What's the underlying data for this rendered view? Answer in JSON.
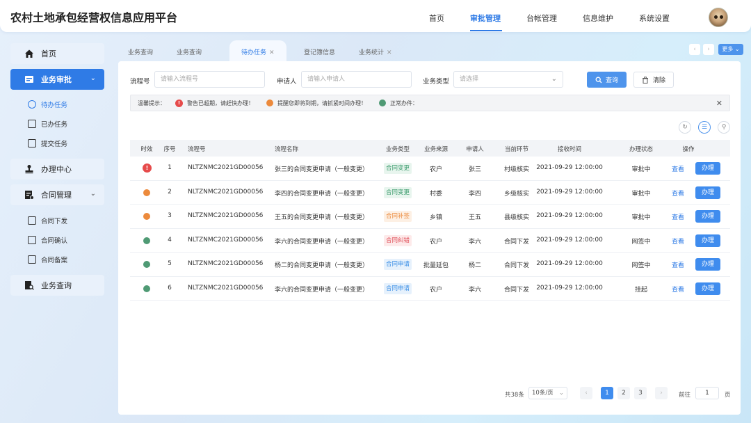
{
  "app": {
    "title": "农村土地承包经营权信息应用平台"
  },
  "topnav": [
    "首页",
    "审批管理",
    "台帐管理",
    "信息维护",
    "系统设置"
  ],
  "sidebar": {
    "home": "首页",
    "approval": "业务审批",
    "todo": "待办任务",
    "done": "已办任务",
    "submitted": "提交任务",
    "center": "办理中心",
    "contract": "合同管理",
    "issue": "合同下发",
    "confirm": "合同确认",
    "record": "合同备案",
    "query": "业务查询"
  },
  "tabs": [
    "业务查询",
    "业务查询",
    "待办任务",
    "登记簿信息",
    "业务统计"
  ],
  "more": "更多",
  "filters": {
    "flow_no_label": "流程号",
    "flow_no_placeholder": "请输入流程号",
    "applicant_label": "申请人",
    "applicant_placeholder": "请输入申请人",
    "type_label": "业务类型",
    "type_placeholder": "请选择",
    "query_btn": "查询",
    "clear_btn": "清除"
  },
  "tips": {
    "label": "温馨提示：",
    "warn": "警告已超期，请赶快办理！",
    "remind": "提醒您即将到期，请抓紧时间办理！",
    "normal": "正常办件："
  },
  "colors": {
    "accent": "#2f7be6",
    "orange": "#ec8a3c",
    "green": "#4f9a74",
    "red": "#e64b4b"
  },
  "table": {
    "headers": [
      "时效",
      "序号",
      "流程号",
      "流程名称",
      "业务类型",
      "业务来源",
      "申请人",
      "当前环节",
      "接收时间",
      "办理状态",
      "操作"
    ],
    "rows": [
      {
        "status": "alarm",
        "no": "1",
        "flow": "NLTZNMC2021GD00056",
        "name": "张三的合同变更申请（一般变更）",
        "type": "合同变更",
        "tag": "green",
        "source": "农户",
        "applicant": "张三",
        "step": "村级核实",
        "time": "2021-09-29 12:00:00",
        "state": "审批中",
        "view": "查看",
        "handle": "办理"
      },
      {
        "status": "orange",
        "no": "2",
        "flow": "NLTZNMC2021GD00056",
        "name": "李四的合同变更申请（一般变更）",
        "type": "合同变更",
        "tag": "green",
        "source": "村委",
        "applicant": "李四",
        "step": "乡级核实",
        "time": "2021-09-29 12:00:00",
        "state": "审批中",
        "view": "查看",
        "handle": "办理"
      },
      {
        "status": "orange",
        "no": "3",
        "flow": "NLTZNMC2021GD00056",
        "name": "王五的合同变更申请（一般变更）",
        "type": "合同补签",
        "tag": "orange",
        "source": "乡镇",
        "applicant": "王五",
        "step": "县级核实",
        "time": "2021-09-29 12:00:00",
        "state": "审批中",
        "view": "查看",
        "handle": "办理"
      },
      {
        "status": "green",
        "no": "4",
        "flow": "NLTZNMC2021GD00056",
        "name": "李六的合同变更申请（一般变更）",
        "type": "合同纠错",
        "tag": "red",
        "source": "农户",
        "applicant": "李六",
        "step": "合同下发",
        "time": "2021-09-29 12:00:00",
        "state": "网签中",
        "view": "查看",
        "handle": "办理"
      },
      {
        "status": "green",
        "no": "5",
        "flow": "NLTZNMC2021GD00056",
        "name": "杨二的合同变更申请（一般变更）",
        "type": "合同申请",
        "tag": "blue",
        "source": "批量延包",
        "applicant": "杨二",
        "step": "合同下发",
        "time": "2021-09-29 12:00:00",
        "state": "网签中",
        "view": "查看",
        "handle": "办理"
      },
      {
        "status": "green",
        "no": "6",
        "flow": "NLTZNMC2021GD00056",
        "name": "李六的合同变更申请（一般变更）",
        "type": "合同申请",
        "tag": "blue",
        "source": "农户",
        "applicant": "李六",
        "step": "合同下发",
        "time": "2021-09-29 12:00:00",
        "state": "挂起",
        "view": "查看",
        "handle": "办理"
      }
    ]
  },
  "pagination": {
    "total": "共38条",
    "page_size": "10条/页",
    "pages": [
      "1",
      "2",
      "3"
    ],
    "goto_label": "前往",
    "goto_value": "1",
    "page_unit": "页"
  }
}
